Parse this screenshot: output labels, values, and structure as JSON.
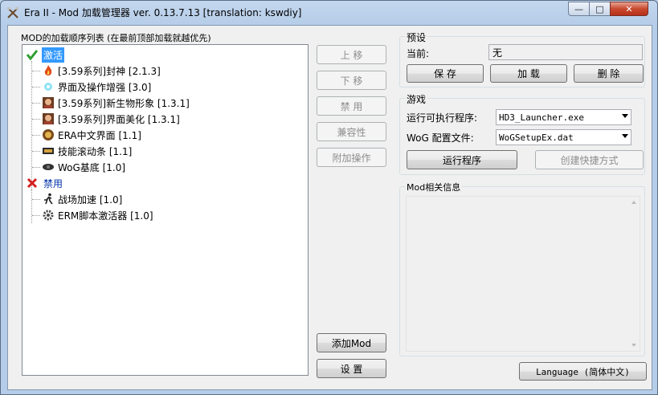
{
  "window": {
    "title": "Era II - Mod 加载管理器 ver. 0.13.7.13 [translation: kswdiy]",
    "controls": {
      "minimize": "—",
      "maximize": "□",
      "close": "✕"
    }
  },
  "mod_list": {
    "caption": "MOD的加载顺序列表 (在最前顶部加载就越优先)",
    "active_group": "激活",
    "active_items": [
      {
        "label": "[3.59系列]封神 [2.1.3]",
        "icon": "flame-icon"
      },
      {
        "label": "界面及操作增强 [3.0]",
        "icon": "sparkle-icon"
      },
      {
        "label": "[3.59系列]新生物形象 [1.3.1]",
        "icon": "portrait-icon"
      },
      {
        "label": "[3.59系列]界面美化 [1.3.1]",
        "icon": "portrait-icon"
      },
      {
        "label": "ERA中文界面 [1.1]",
        "icon": "shield-icon"
      },
      {
        "label": "技能滚动条 [1.1]",
        "icon": "scroll-icon"
      },
      {
        "label": "WoG基底 [1.0]",
        "icon": "eye-icon"
      }
    ],
    "disabled_group": "禁用",
    "disabled_items": [
      {
        "label": "战场加速 [1.0]",
        "icon": "runner-icon"
      },
      {
        "label": "ERM脚本激活器 [1.0]",
        "icon": "gear-icon"
      }
    ]
  },
  "mid_buttons": {
    "move_up": "上 移",
    "move_down": "下 移",
    "disable": "禁 用",
    "compat": "兼容性",
    "extra": "附加操作",
    "add_mod": "添加Mod",
    "settings": "设 置"
  },
  "preset": {
    "title": "预设",
    "current_label": "当前:",
    "current_value": "无",
    "save": "保 存",
    "load": "加 载",
    "delete": "删 除"
  },
  "game": {
    "title": "游戏",
    "exe_label": "运行可执行程序:",
    "exe_value": "HD3_Launcher.exe",
    "config_label": "WoG 配置文件:",
    "config_value": "WoGSetupEx.dat",
    "run": "运行程序",
    "shortcut": "创建快捷方式"
  },
  "info": {
    "title": "Mod相关信息"
  },
  "language_button": "Language (简体中文)",
  "colors": {
    "selection": "#3399ff",
    "active_check": "#2e9e2e",
    "disabled_x": "#d42020"
  }
}
